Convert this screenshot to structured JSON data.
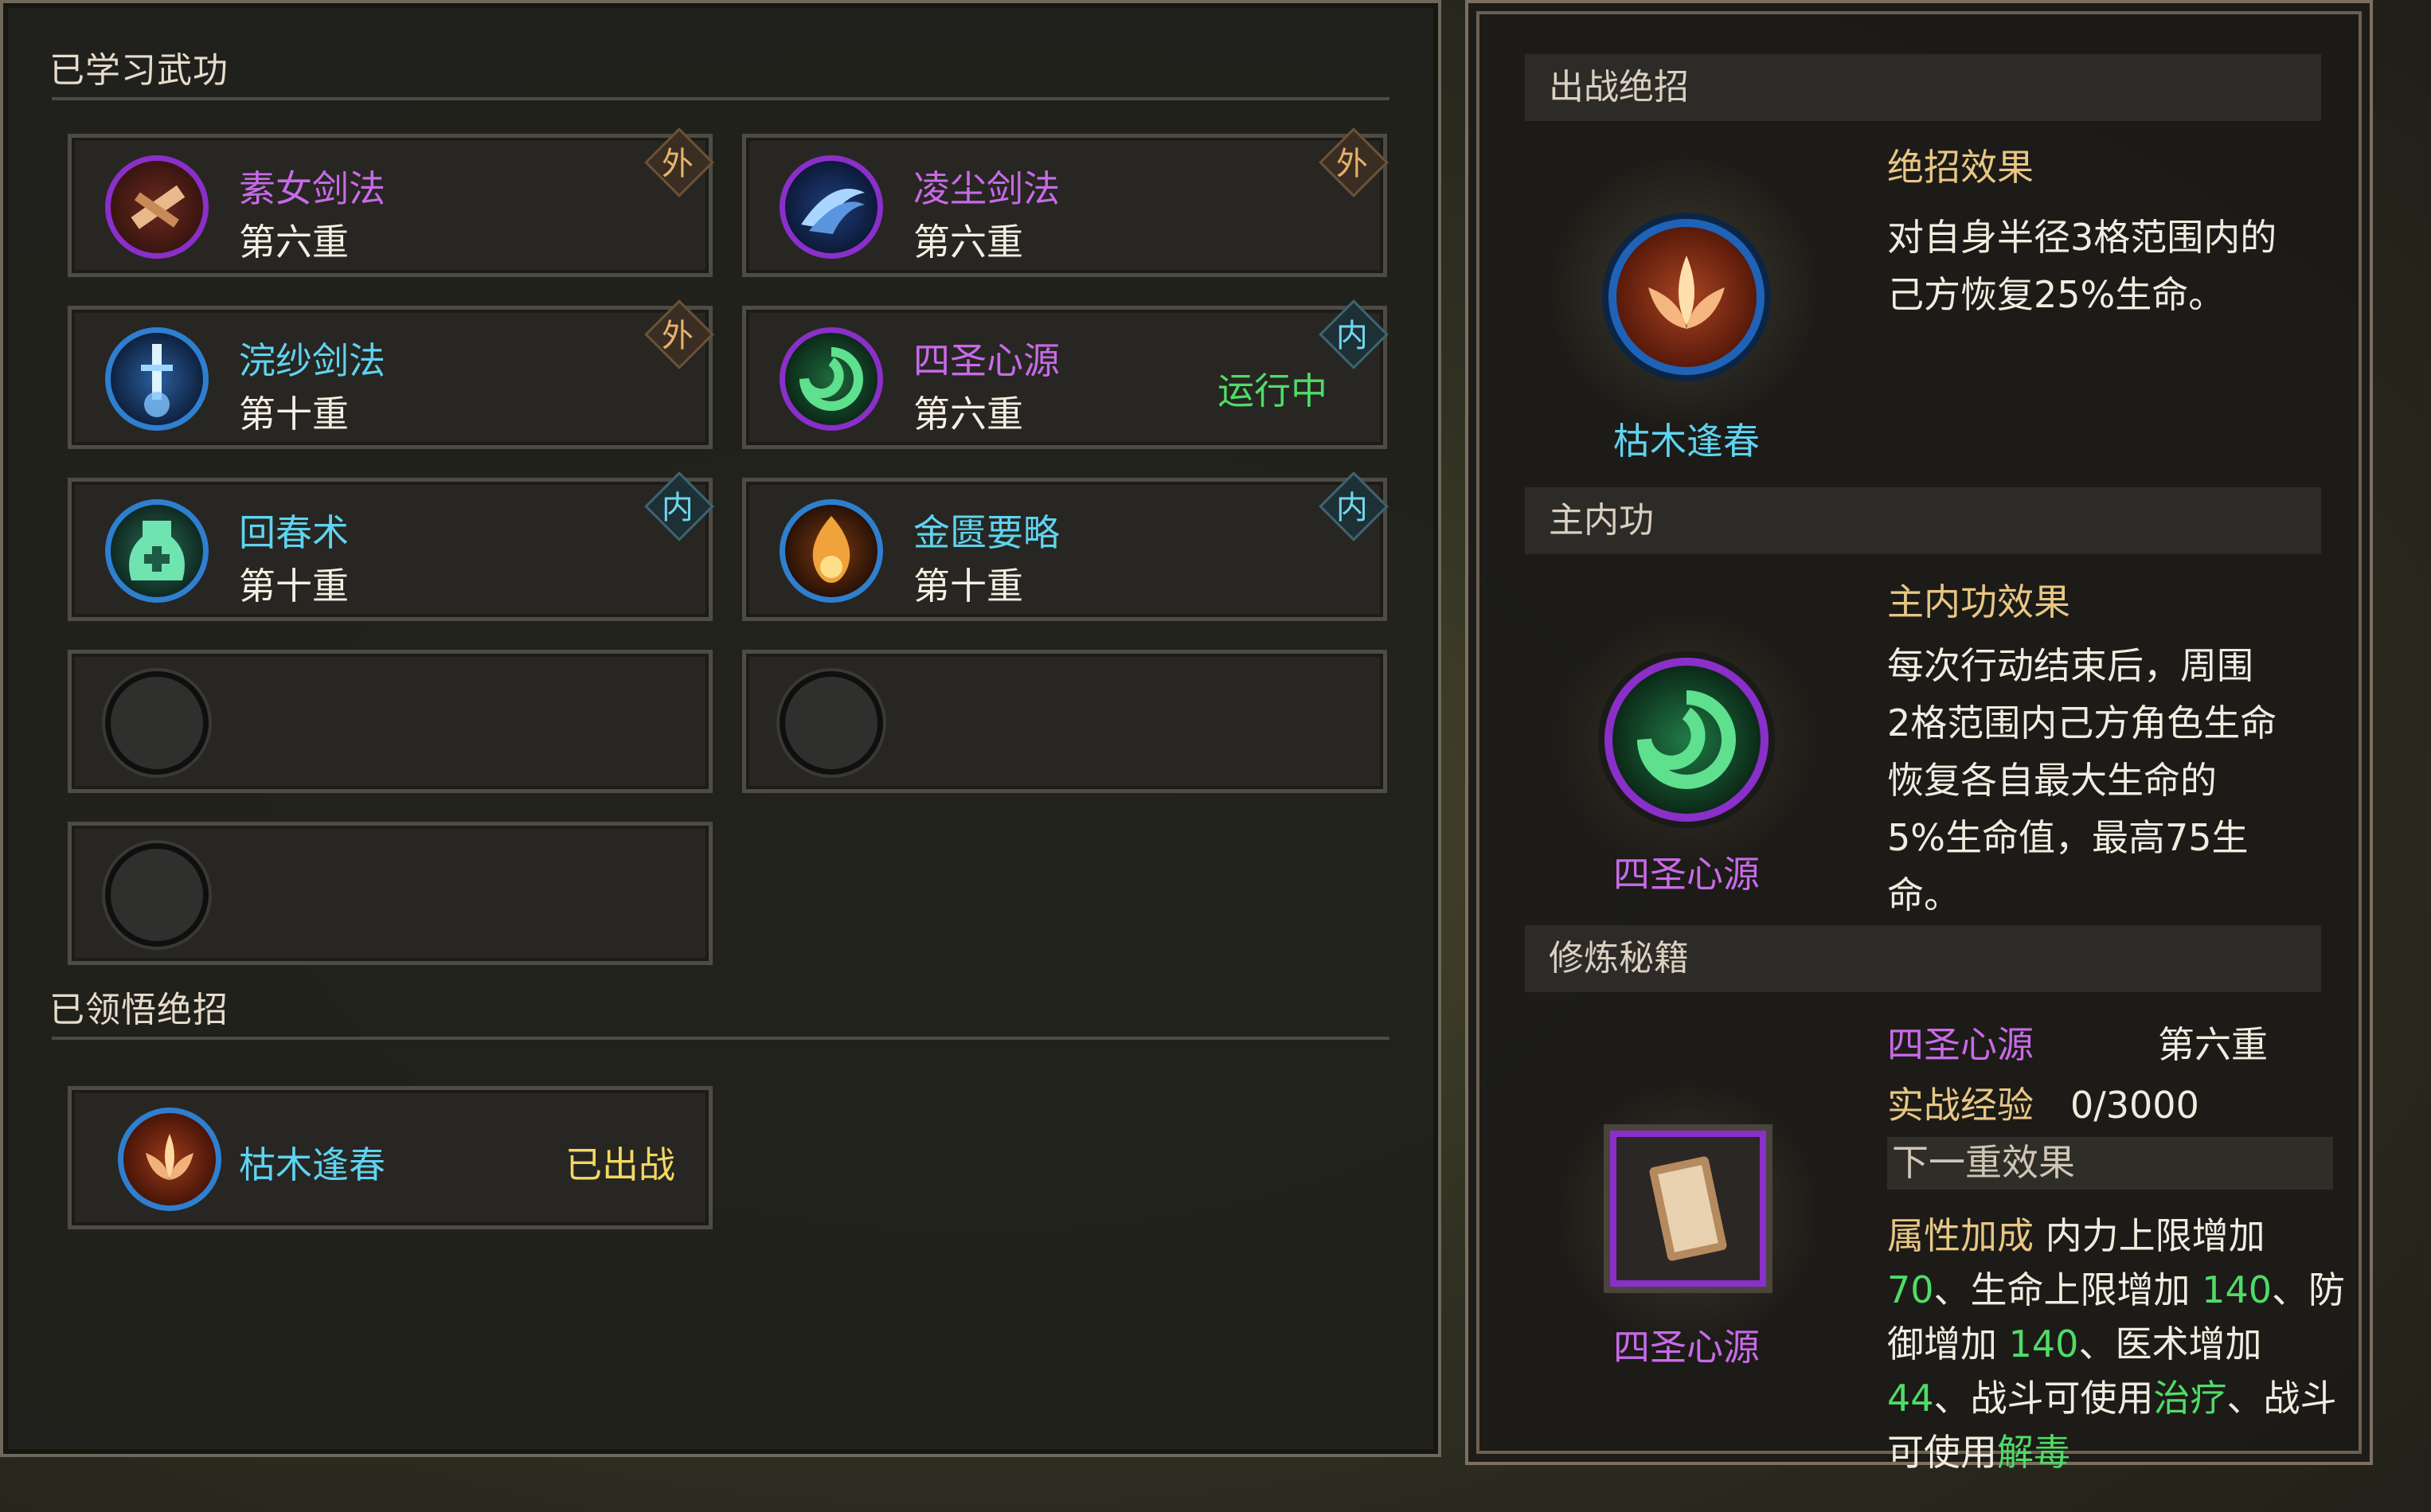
{
  "learned": {
    "title": "已学习武功",
    "cards": [
      {
        "name": "素女剑法",
        "level": "第六重",
        "badge": "外",
        "status": ""
      },
      {
        "name": "凌尘剑法",
        "level": "第六重",
        "badge": "外",
        "status": ""
      },
      {
        "name": "浣纱剑法",
        "level": "第十重",
        "badge": "外",
        "status": ""
      },
      {
        "name": "四圣心源",
        "level": "第六重",
        "badge": "内",
        "status": "运行中"
      },
      {
        "name": "回春术",
        "level": "第十重",
        "badge": "内",
        "status": ""
      },
      {
        "name": "金匮要略",
        "level": "第十重",
        "badge": "内",
        "status": ""
      }
    ]
  },
  "ultimates": {
    "title": "已领悟绝招",
    "card": {
      "name": "枯木逢春",
      "status": "已出战"
    }
  },
  "right": {
    "battle": {
      "header": "出战绝招",
      "effect_title": "绝招效果",
      "effect_lines": [
        "对自身半径3格范围内的",
        "己方恢复25%生命。"
      ],
      "skill_name": "枯木逢春"
    },
    "main_inner": {
      "header": "主内功",
      "effect_title": "主内功效果",
      "effect_lines": [
        "每次行动结束后，周围",
        "2格范围内己方角色生命",
        "恢复各自最大生命的",
        "5%生命值，最高75生",
        "命。"
      ],
      "skill_name": "四圣心源"
    },
    "training": {
      "header": "修炼秘籍",
      "skill_name": "四圣心源",
      "level": "第六重",
      "exp_label": "实战经验",
      "exp_value": "0/3000",
      "next_title": "下一重效果",
      "attr_label": "属性加成",
      "line1": "内力上限增加",
      "v1": "70",
      "t2": "、生命上限增加 ",
      "v2": "140",
      "t3": "、防",
      "t4": "御增加 ",
      "v3": "140",
      "t5": "、医术增加",
      "v4": "44",
      "t6": "、战斗可使用",
      "s1": "治疗",
      "t7": "、战斗",
      "t8": "可使用",
      "s2": "解毒",
      "book_name": "四圣心源"
    }
  },
  "colors": {
    "purple": "#c86ae8",
    "cyan": "#5fd3f0",
    "green": "#4fdc68",
    "yellow": "#f3d861",
    "gold": "#e8c684"
  }
}
